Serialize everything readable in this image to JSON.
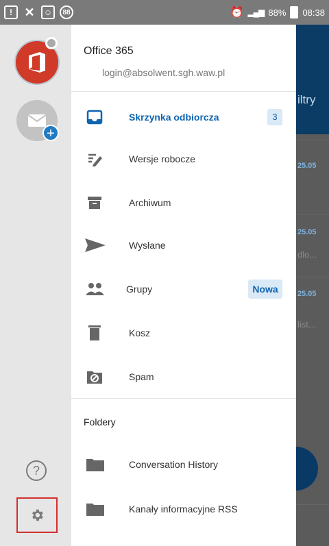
{
  "status_bar": {
    "notif_badge": "88",
    "battery": "88%",
    "time": "08:38"
  },
  "accounts": [
    {
      "name": "Office 365",
      "email": "login@absolwent.sgh.waw.pl"
    }
  ],
  "nav": {
    "items": [
      {
        "label": "Skrzynka odbiorcza",
        "icon": "inbox-icon",
        "badge": "3",
        "active": true
      },
      {
        "label": "Wersje robocze",
        "icon": "drafts-icon"
      },
      {
        "label": "Archiwum",
        "icon": "archive-icon"
      },
      {
        "label": "Wysłane",
        "icon": "send-icon"
      },
      {
        "label": "Grupy",
        "icon": "groups-icon",
        "badge": "Nowa"
      },
      {
        "label": "Kosz",
        "icon": "trash-icon"
      },
      {
        "label": "Spam",
        "icon": "spam-icon"
      }
    ]
  },
  "folders": {
    "title": "Foldery",
    "items": [
      {
        "label": "Conversation History",
        "icon": "folder-icon"
      },
      {
        "label": "Kanały informacyjne RSS",
        "icon": "folder-icon"
      }
    ]
  },
  "background": {
    "header_text": "iltry",
    "rows": [
      {
        "date": "25.05",
        "snippet": ""
      },
      {
        "date": "25.05",
        "snippet": "dlo..."
      },
      {
        "date": "25.05",
        "snippet": "list..."
      }
    ]
  },
  "colors": {
    "accent": "#1065b1",
    "office_red": "#cf3a29",
    "settings_highlight": "#d32f2f"
  }
}
